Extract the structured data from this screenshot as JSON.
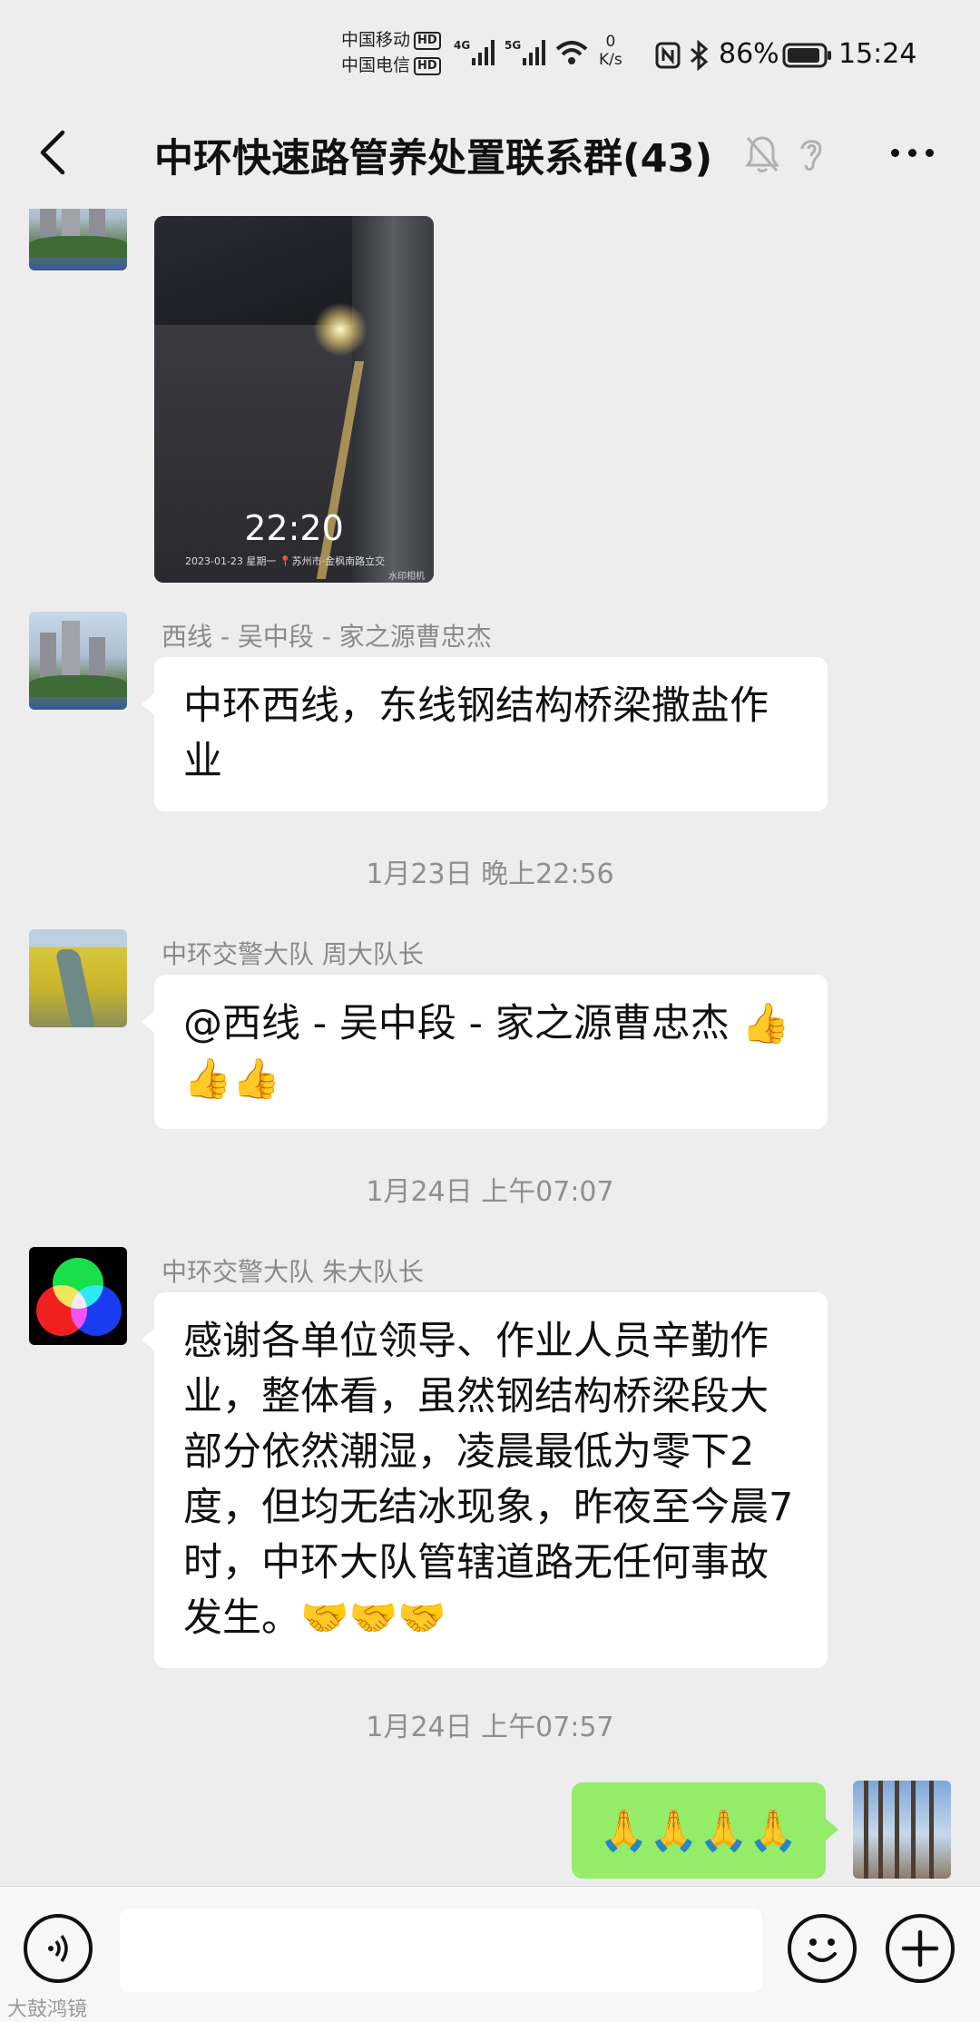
{
  "status_bar": {
    "carrier1": "中国移动",
    "carrier2": "中国电信",
    "hd": "HD",
    "net1": "4G",
    "net2": "5G",
    "speed_value": "0",
    "speed_unit": "K/s",
    "battery": "86%",
    "time": "15:24"
  },
  "header": {
    "title": "中环快速路管养处置联系群(43)"
  },
  "messages": {
    "photo": {
      "time": "22:20",
      "info": "2023-01-23 星期一 📍苏州市·金枫南路立交",
      "watermark": "水印相机"
    },
    "m1": {
      "sender": "西线 - 吴中段 - 家之源曹忠杰",
      "text": "中环西线，东线钢结构桥梁撒盐作业"
    },
    "ts1": "1月23日 晚上22:56",
    "m2": {
      "sender": "中环交警大队  周大队长",
      "text": "@西线 - 吴中段 - 家之源曹忠杰 👍👍👍"
    },
    "ts2": "1月24日 上午07:07",
    "m3": {
      "sender": "中环交警大队  朱大队长",
      "text": "感谢各单位领导、作业人员辛勤作业，整体看，虽然钢结构桥梁段大部分依然潮湿，凌晨最低为零下2度，但均无结冰现象，昨夜至今晨7时，中环大队管辖道路无任何事故发生。🤝🤝🤝"
    },
    "ts3": "1月24日 上午07:57",
    "m4": {
      "text": "🙏🙏🙏🙏"
    }
  },
  "footer": {
    "watermark": "大鼓鸿镜"
  },
  "colors": {
    "background": "#ededed",
    "my_bubble": "#95ec69",
    "other_bubble": "#ffffff"
  }
}
